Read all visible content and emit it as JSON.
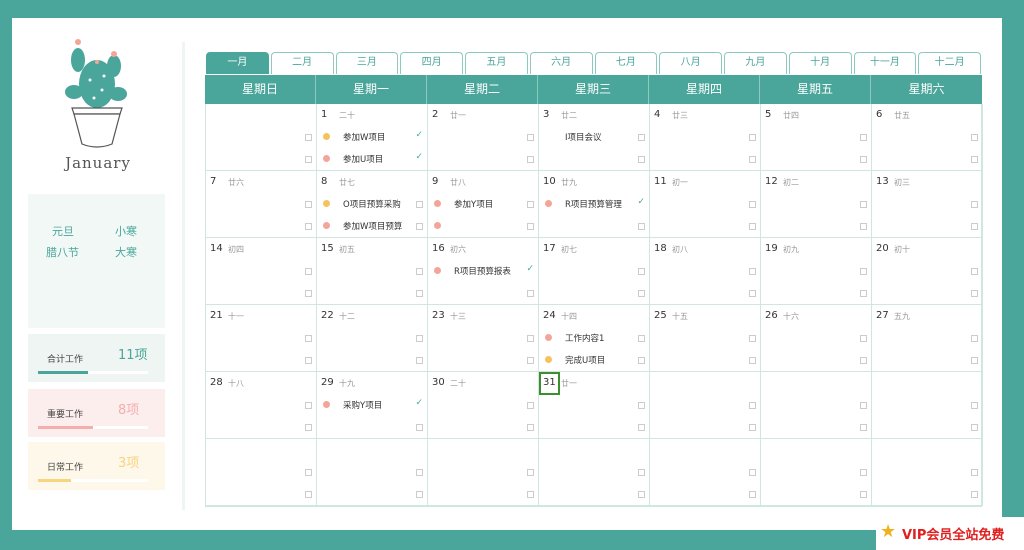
{
  "sidebar": {
    "month": "January",
    "holidays": [
      "元旦",
      "小寒",
      "腊八节",
      "大寒"
    ],
    "stats": [
      {
        "label": "合计工作",
        "value": "11项",
        "progress": 0.45,
        "color": "#4aa59a",
        "bg": "#eef5f3",
        "track": "#4aa59a"
      },
      {
        "label": "重要工作",
        "value": "8项",
        "progress": 0.5,
        "color": "#f4aeae",
        "bg": "#fdeeee",
        "track": "#f4aeae"
      },
      {
        "label": "日常工作",
        "value": "3项",
        "progress": 0.3,
        "color": "#f7d47e",
        "bg": "#fdf8ea",
        "track": "#f7d47e"
      }
    ]
  },
  "calendar": {
    "months": [
      "一月",
      "二月",
      "三月",
      "四月",
      "五月",
      "六月",
      "七月",
      "八月",
      "九月",
      "十月",
      "十一月",
      "十二月"
    ],
    "active_month": 0,
    "weekdays": [
      "星期日",
      "星期一",
      "星期二",
      "星期三",
      "星期四",
      "星期五",
      "星期六"
    ],
    "today": 31,
    "colors": {
      "important": "#f4a59a",
      "routine": "#f7c25e"
    },
    "days": [
      {
        "d": "",
        "l": ""
      },
      {
        "d": "1",
        "l": "二十"
      },
      {
        "d": "2",
        "l": "廿一"
      },
      {
        "d": "3",
        "l": "廿二"
      },
      {
        "d": "4",
        "l": "廿三"
      },
      {
        "d": "5",
        "l": "廿四"
      },
      {
        "d": "6",
        "l": "廿五"
      },
      {
        "d": "7",
        "l": "廿六"
      },
      {
        "d": "8",
        "l": "廿七"
      },
      {
        "d": "9",
        "l": "廿八"
      },
      {
        "d": "10",
        "l": "廿九"
      },
      {
        "d": "11",
        "l": "初一"
      },
      {
        "d": "12",
        "l": "初二"
      },
      {
        "d": "13",
        "l": "初三"
      },
      {
        "d": "14",
        "l": "初四"
      },
      {
        "d": "15",
        "l": "初五"
      },
      {
        "d": "16",
        "l": "初六"
      },
      {
        "d": "17",
        "l": "初七"
      },
      {
        "d": "18",
        "l": "初八"
      },
      {
        "d": "19",
        "l": "初九"
      },
      {
        "d": "20",
        "l": "初十"
      },
      {
        "d": "21",
        "l": "十一"
      },
      {
        "d": "22",
        "l": "十二"
      },
      {
        "d": "23",
        "l": "十三"
      },
      {
        "d": "24",
        "l": "十四"
      },
      {
        "d": "25",
        "l": "十五"
      },
      {
        "d": "26",
        "l": "十六"
      },
      {
        "d": "27",
        "l": "五九"
      },
      {
        "d": "28",
        "l": "十八"
      },
      {
        "d": "29",
        "l": "十九"
      },
      {
        "d": "30",
        "l": "二十"
      },
      {
        "d": "31",
        "l": "廿一"
      },
      {
        "d": "",
        "l": ""
      },
      {
        "d": "",
        "l": ""
      },
      {
        "d": "",
        "l": ""
      },
      {
        "d": "",
        "l": ""
      },
      {
        "d": "",
        "l": ""
      },
      {
        "d": "",
        "l": ""
      },
      {
        "d": "",
        "l": ""
      },
      {
        "d": "",
        "l": ""
      },
      {
        "d": "",
        "l": ""
      },
      {
        "d": "",
        "l": ""
      }
    ],
    "tasks": [
      {
        "day": "1",
        "slot": 0,
        "text": "参加W项目",
        "kind": "routine",
        "done": true
      },
      {
        "day": "1",
        "slot": 1,
        "text": "参加U项目",
        "kind": "important",
        "done": true
      },
      {
        "day": "3",
        "slot": 0,
        "text": "I项目会议",
        "kind": "",
        "done": false
      },
      {
        "day": "8",
        "slot": 0,
        "text": "O项目预算采购",
        "kind": "routine",
        "done": false
      },
      {
        "day": "8",
        "slot": 1,
        "text": "参加W项目预算",
        "kind": "important",
        "done": false
      },
      {
        "day": "9",
        "slot": 0,
        "text": "参加Y项目",
        "kind": "important",
        "done": false
      },
      {
        "day": "9",
        "slot": 1,
        "text": "",
        "kind": "important",
        "done": false
      },
      {
        "day": "10",
        "slot": 0,
        "text": "R项目预算管理",
        "kind": "important",
        "done": true
      },
      {
        "day": "16",
        "slot": 0,
        "text": "R项目预算报表",
        "kind": "important",
        "done": true
      },
      {
        "day": "24",
        "slot": 0,
        "text": "工作内容1",
        "kind": "important",
        "done": false
      },
      {
        "day": "24",
        "slot": 1,
        "text": "完成U项目",
        "kind": "routine",
        "done": false
      },
      {
        "day": "29",
        "slot": 0,
        "text": "采购Y项目",
        "kind": "important",
        "done": true
      }
    ],
    "check_mark": "✓"
  },
  "watermark": {
    "text": "VIP会员全站免费",
    "icon": "star-icon"
  }
}
